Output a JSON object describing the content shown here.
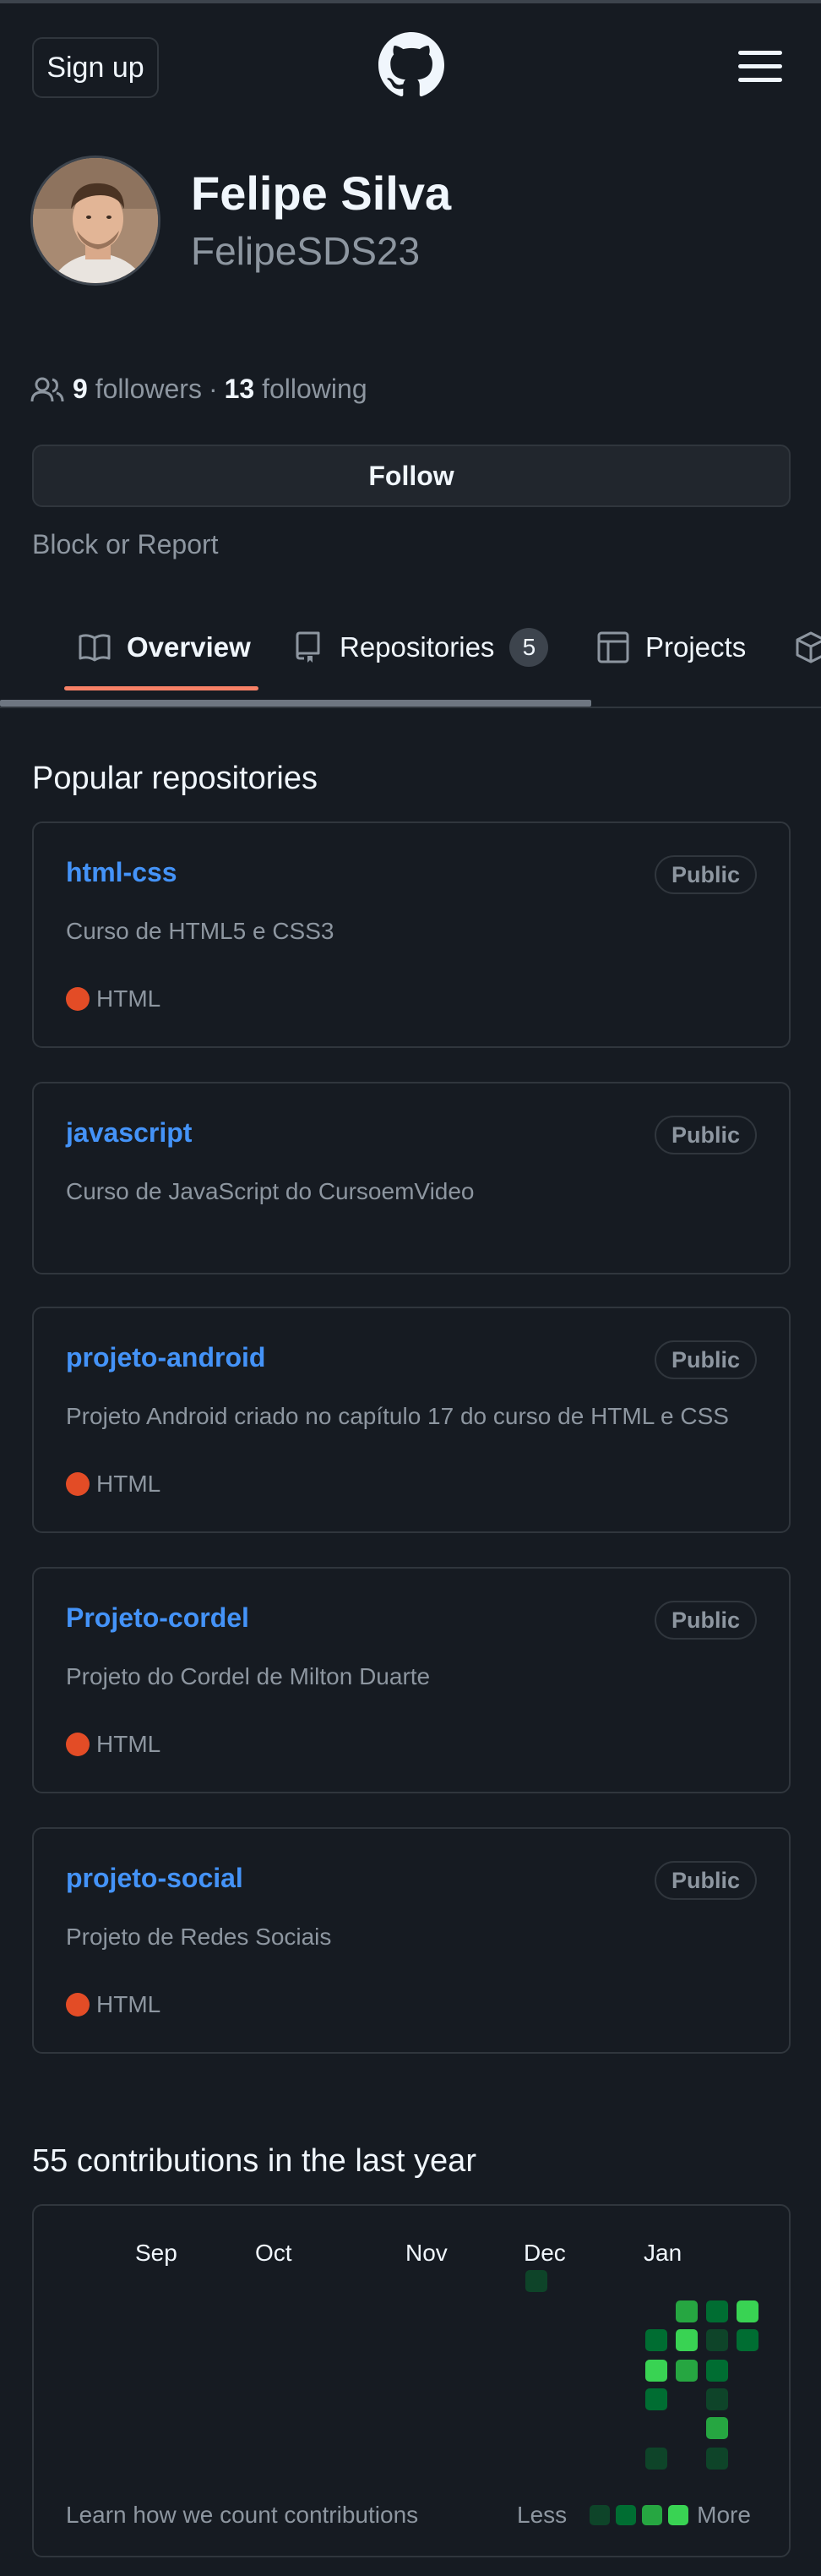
{
  "header": {
    "signup_label": "Sign up",
    "logo_icon": "github-icon",
    "menu_icon": "hamburger-icon"
  },
  "profile": {
    "name": "Felipe Silva",
    "login": "FelipeSDS23",
    "followers_count": "9",
    "followers_label": "followers",
    "separator": "·",
    "following_count": "13",
    "following_label": "following",
    "follow_button": "Follow",
    "block_report": "Block or Report"
  },
  "tabs": [
    {
      "label": "Overview",
      "icon": "book-icon"
    },
    {
      "label": "Repositories",
      "icon": "repo-icon",
      "count": "5"
    },
    {
      "label": "Projects",
      "icon": "table-icon"
    },
    {
      "label": "",
      "icon": "package-icon"
    }
  ],
  "popular": {
    "title": "Popular repositories",
    "repos": [
      {
        "name": "html-css",
        "visibility": "Public",
        "description": "Curso de HTML5 e CSS3",
        "language": "HTML"
      },
      {
        "name": "javascript",
        "visibility": "Public",
        "description": "Curso de JavaScript do CursoemVideo",
        "language": ""
      },
      {
        "name": "projeto-android",
        "visibility": "Public",
        "description": "Projeto Android criado no capítulo 17 do curso de HTML e CSS",
        "language": "HTML"
      },
      {
        "name": "Projeto-cordel",
        "visibility": "Public",
        "description": "Projeto do Cordel de Milton Duarte",
        "language": "HTML"
      },
      {
        "name": "projeto-social",
        "visibility": "Public",
        "description": "Projeto de Redes Sociais",
        "language": "HTML"
      }
    ]
  },
  "contributions": {
    "title": "55 contributions in the last year",
    "months": [
      "Sep",
      "Oct",
      "Nov",
      "Dec",
      "Jan"
    ],
    "learn_link": "Learn how we count contributions",
    "legend_less": "Less",
    "legend_more": "More",
    "colors": {
      "level1": "#0e4429",
      "level2": "#006d32",
      "level3": "#26a641",
      "level4": "#39d353"
    }
  }
}
